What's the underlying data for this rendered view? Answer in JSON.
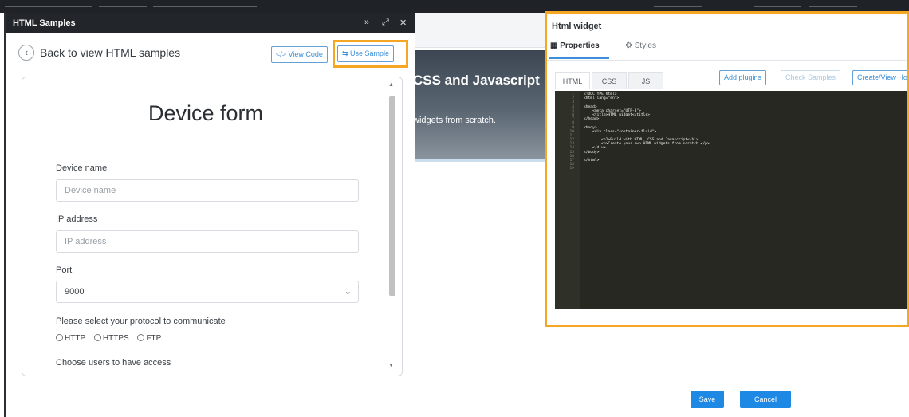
{
  "samples_panel": {
    "title": "HTML Samples",
    "header_buttons": [
      "»",
      "⤢",
      "✕"
    ],
    "back_label": "Back to view HTML samples",
    "view_code_label": "</> View Code",
    "use_sample_label": "⇆ Use Sample"
  },
  "form": {
    "title": "Device form",
    "device_name_label": "Device name",
    "device_name_placeholder": "Device name",
    "ip_label": "IP address",
    "ip_placeholder": "IP address",
    "port_label": "Port",
    "port_value": "9000",
    "protocol_label": "Please select your protocol to communicate",
    "protocols": [
      "HTTP",
      "HTTPS",
      "FTP"
    ],
    "users_label": "Choose users to have access"
  },
  "background_page": {
    "hero_title": "CSS and Javascript",
    "hero_subtitle": "widgets from scratch."
  },
  "widget_panel": {
    "title": "Html widget",
    "tabs": [
      "Properties",
      "Styles"
    ],
    "code_tabs": [
      "HTML",
      "CSS",
      "JS"
    ],
    "add_plugins_label": "Add plugins",
    "check_samples_label": "Check Samples",
    "create_view_label": "Create/View Ho",
    "save_label": "Save",
    "cancel_label": "Cancel"
  },
  "code_lines": [
    "<!DOCTYPE html>",
    "<html lang=\"en\">",
    "",
    "<head>",
    "    <meta charset=\"UTF-8\">",
    "    <title>HTML widget</title>",
    "</head>",
    "",
    "<body>",
    "    <div class=\"container-fluid\">",
    "",
    "        <h1>Build with HTML, CSS and Javascript</h1>",
    "        <p>Create your own HTML widgets from scratch.</p>",
    "    </div>",
    "</body>",
    "",
    "</html>",
    ""
  ],
  "line_numbers": [
    "1",
    "2",
    "3",
    "4",
    "5",
    "6",
    "7",
    "8",
    "9",
    "10",
    "11",
    "12",
    "13",
    "14",
    "15",
    "16",
    "17",
    "18",
    "19"
  ],
  "colors": {
    "highlight": "#f5a623",
    "primary": "#1e88e5",
    "accent_outline": "#3b8fd9",
    "editor_bg": "#272822"
  }
}
